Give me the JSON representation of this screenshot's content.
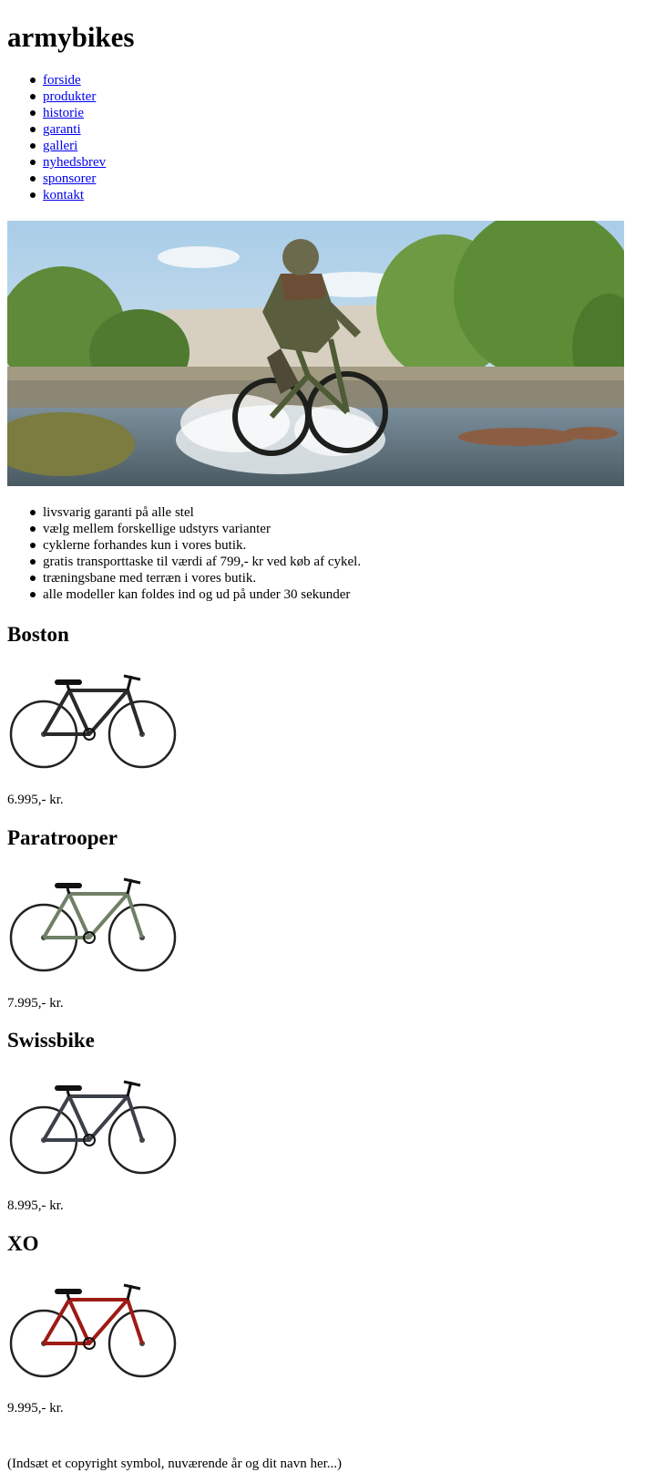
{
  "site": {
    "title": "armybikes"
  },
  "nav": {
    "items": [
      {
        "label": "forside"
      },
      {
        "label": "produkter"
      },
      {
        "label": "historie"
      },
      {
        "label": "garanti"
      },
      {
        "label": "galleri"
      },
      {
        "label": "nyhedsbrev"
      },
      {
        "label": "sponsorer"
      },
      {
        "label": "kontakt"
      }
    ]
  },
  "features": [
    "livsvarig garanti på alle stel",
    "vælg mellem forskellige udstyrs varianter",
    "cyklerne forhandes kun i vores butik.",
    "gratis transporttaske til værdi af 799,- kr ved køb af cykel.",
    "træningsbane med terræn i vores butik.",
    "alle modeller kan foldes ind og ud på under 30 sekunder"
  ],
  "products": [
    {
      "name": "Boston",
      "price": "6.995,- kr.",
      "frame_color": "#2a2a2a"
    },
    {
      "name": "Paratrooper",
      "price": "7.995,- kr.",
      "frame_color": "#6f8066"
    },
    {
      "name": "Swissbike",
      "price": "8.995,- kr.",
      "frame_color": "#3c4048"
    },
    {
      "name": "XO",
      "price": "9.995,- kr.",
      "frame_color": "#9e1a14"
    }
  ],
  "footer": {
    "text": "(Indsæt et copyright symbol, nuværende år og dit navn her...)"
  },
  "colors": {
    "link": "#0000ee",
    "text": "#000000",
    "background": "#ffffff"
  }
}
